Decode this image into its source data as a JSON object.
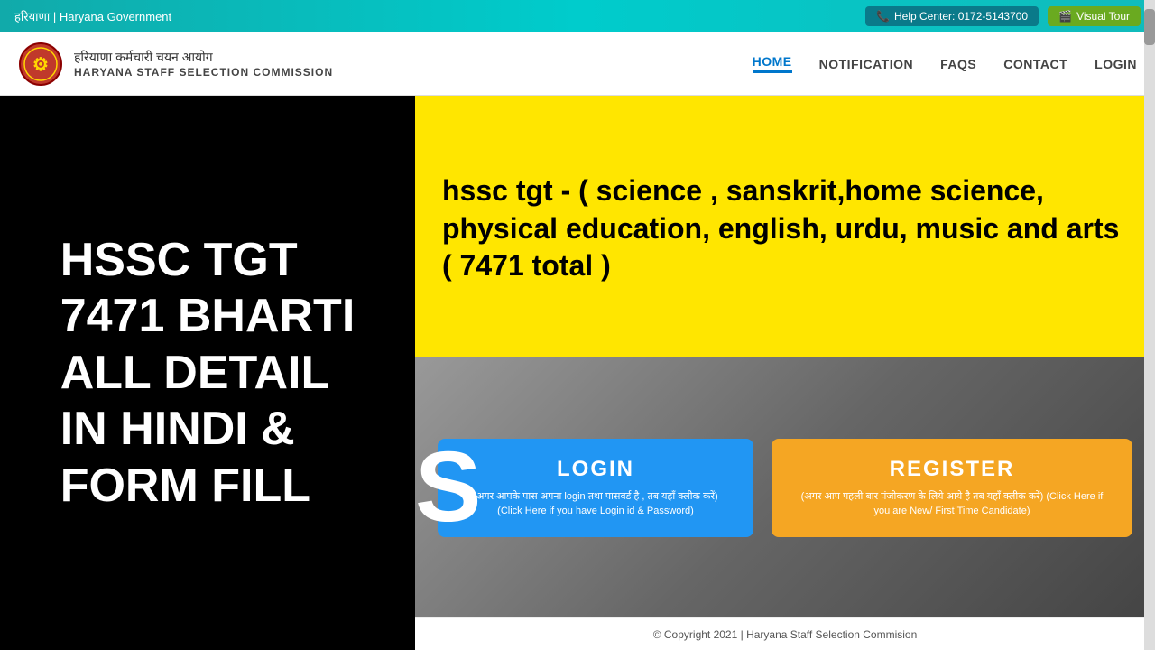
{
  "topbar": {
    "gov_label": "हरियाणा | Haryana Government",
    "help_label": "Help Center: 0172-5143700",
    "visual_tour_label": "Visual Tour"
  },
  "header": {
    "logo_hindi": "हरियाणा कर्मचारी चयन आयोग",
    "logo_english": "HARYANA STAFF SELECTION COMMISSION",
    "nav": [
      {
        "label": "HOME",
        "active": true
      },
      {
        "label": "NOTIFICATION",
        "active": false
      },
      {
        "label": "FAQS",
        "active": false
      },
      {
        "label": "CONTACT",
        "active": false
      },
      {
        "label": "LOGIN",
        "active": false
      }
    ]
  },
  "left_panel": {
    "text": "HSSC TGT\n7471 BHARTI\nALL DETAIL\nIN HINDI &\nFORM FILL"
  },
  "yellow_banner": {
    "text": "hssc tgt - ( science , sanskrit,home science, physical education, english, urdu, music and arts ( 7471 total )"
  },
  "login_box": {
    "title": "LOGIN",
    "sub_hindi": "(अगर आपके पास अपना login तथा पासवर्ड है , तब यहाँ क्लीक करें)",
    "sub_english": "(Click Here if you have Login id & Password)"
  },
  "register_box": {
    "title": "REGISTER",
    "sub_hindi": "(अगर आप पहली बार पंजीकरण के लिये आये है तब यहाँ क्लीक करें) (Click Here if you are New/ First Time Candidate)"
  },
  "footer": {
    "text": "© Copyright 2021 | Haryana Staff Selection Commision"
  }
}
